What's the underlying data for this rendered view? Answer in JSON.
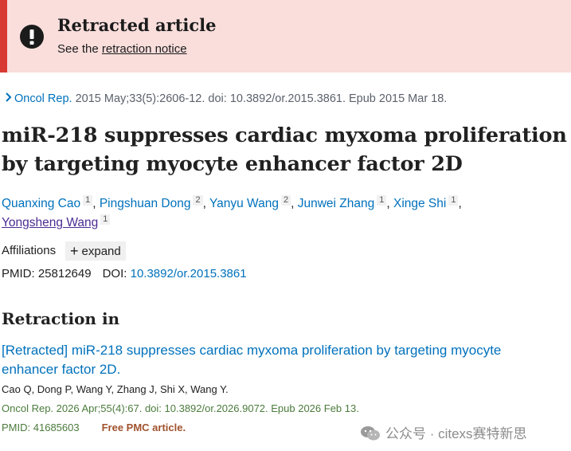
{
  "banner": {
    "title": "Retracted article",
    "text_prefix": "See the ",
    "link": "retraction notice",
    "icon": "exclamation-circle-icon",
    "bg_color": "#f9dedc",
    "accent_color": "#d83933"
  },
  "citation": {
    "journal": "Oncol Rep.",
    "details": " 2015 May;33(5):2606-12. doi: 10.3892/or.2015.3861. Epub 2015 Mar 18."
  },
  "article": {
    "title": "miR-218 suppresses cardiac myxoma proliferation by targeting myocyte enhancer factor 2D"
  },
  "authors": [
    {
      "name": "Quanxing Cao",
      "aff": "1"
    },
    {
      "name": "Pingshuan Dong",
      "aff": "2"
    },
    {
      "name": "Yanyu Wang",
      "aff": "2"
    },
    {
      "name": "Junwei Zhang",
      "aff": "1"
    },
    {
      "name": "Xinge Shi",
      "aff": "1"
    },
    {
      "name": "Yongsheng Wang",
      "aff": "1"
    }
  ],
  "affiliations": {
    "label": "Affiliations",
    "expand_label": "expand"
  },
  "ids": {
    "pmid_label": "PMID:",
    "pmid": "25812649",
    "doi_label": "DOI:",
    "doi": "10.3892/or.2015.3861"
  },
  "retraction": {
    "heading": "Retraction in",
    "title": "[Retracted] miR-218 suppresses cardiac myxoma proliferation by targeting myocyte enhancer factor 2D.",
    "authors": "Cao Q, Dong P, Wang Y, Zhang J, Shi X, Wang Y.",
    "citation": "Oncol Rep. 2026 Apr;55(4):67. doi: 10.3892/or.2026.9072. Epub 2026 Feb 13.",
    "pmid_label": "PMID:",
    "pmid": "41685603",
    "free_label": "Free PMC article."
  },
  "watermark": {
    "text": "公众号 · citexs赛特新思",
    "icon": "wechat-icon"
  }
}
